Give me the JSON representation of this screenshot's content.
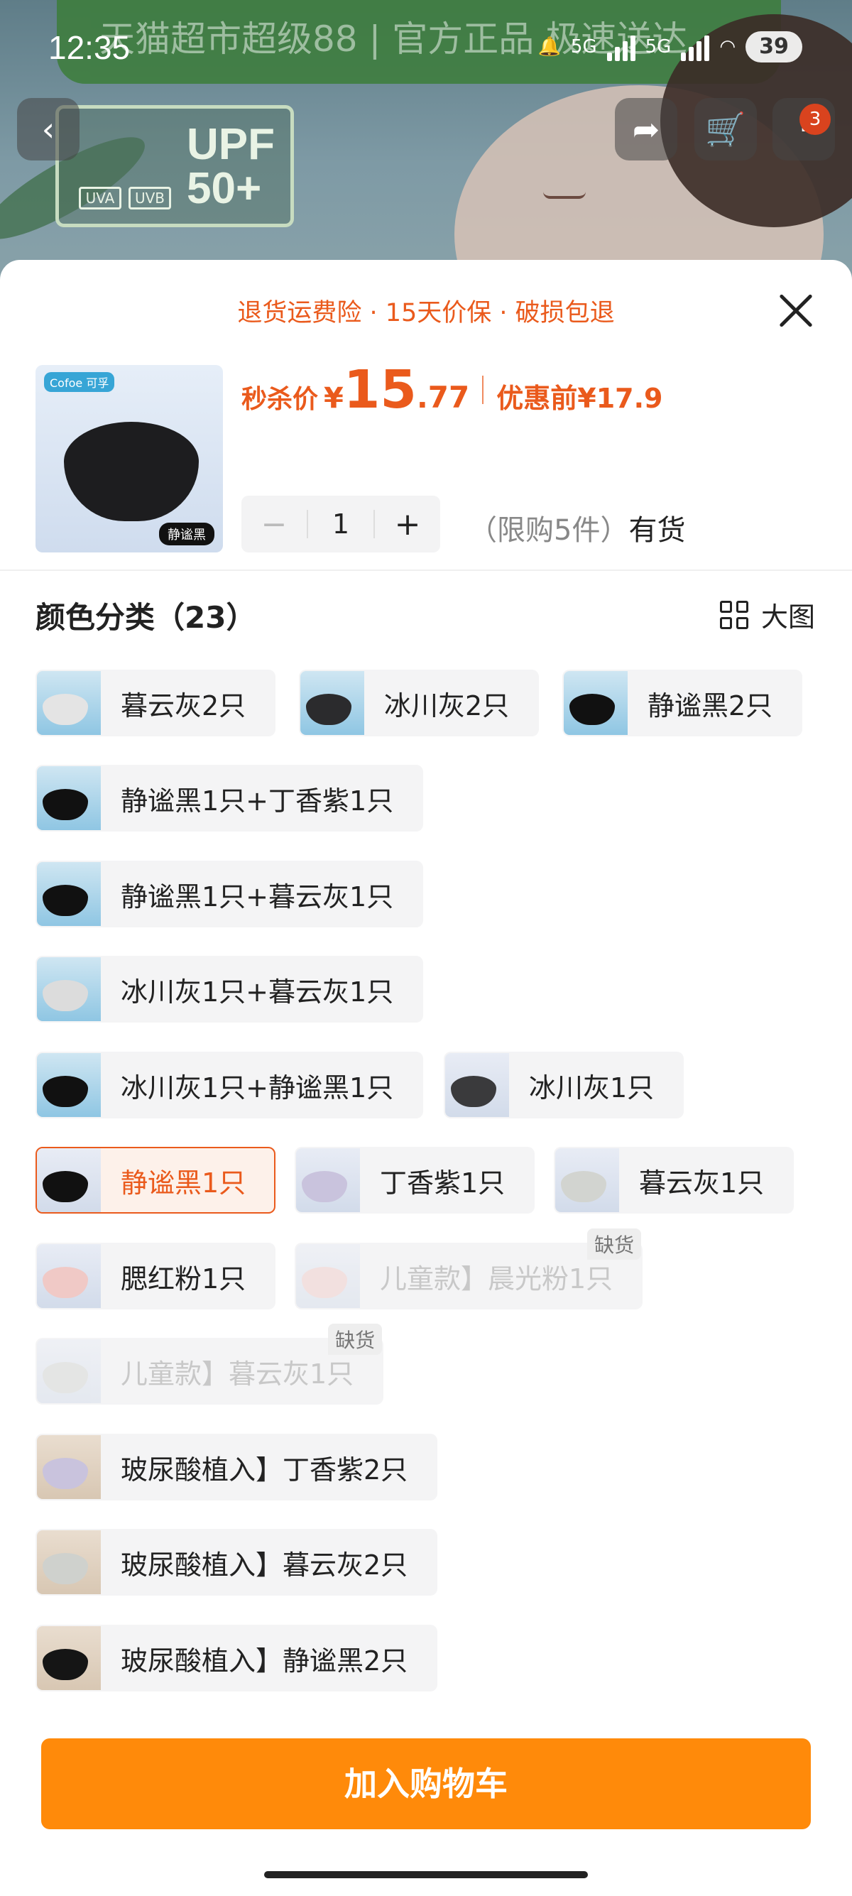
{
  "status_bar": {
    "time": "12:35",
    "network_1": "5G",
    "network_2": "5G",
    "battery": "39"
  },
  "background": {
    "banner_text": "天猫超市超级88 | 官方正品 极速送达",
    "upf_text": "UPF 50+",
    "uva": "UVA",
    "uvb": "UVB"
  },
  "nav": {
    "cart_badge": "3"
  },
  "sheet": {
    "promise": "退货运费险 · 15天价保 · 破损包退",
    "product": {
      "logo": "Cofoe 可孚",
      "tag": "静谧黑"
    },
    "price": {
      "label": "秒杀价",
      "currency": "¥",
      "integer": "15",
      "decimal": ".77",
      "original_label": "优惠前",
      "original": "¥17.9"
    },
    "quantity": {
      "minus": "−",
      "value": "1",
      "plus": "+"
    },
    "stock": {
      "limit": "（限购5件）",
      "status": "有货"
    },
    "category": {
      "title": "颜色分类（23）",
      "big_image": "大图"
    },
    "options": [
      {
        "label": "暮云灰2只"
      },
      {
        "label": "冰川灰2只"
      },
      {
        "label": "静谧黑2只"
      },
      {
        "label": "静谧黑1只+丁香紫1只"
      },
      {
        "label": "静谧黑1只+暮云灰1只"
      },
      {
        "label": "冰川灰1只+暮云灰1只"
      },
      {
        "label": "冰川灰1只+静谧黑1只"
      },
      {
        "label": "冰川灰1只"
      },
      {
        "label": "静谧黑1只",
        "selected": true
      },
      {
        "label": "丁香紫1只"
      },
      {
        "label": "暮云灰1只"
      },
      {
        "label": "腮红粉1只"
      },
      {
        "label": "儿童款】晨光粉1只",
        "out_of_stock": true
      },
      {
        "label": "儿童款】暮云灰1只",
        "out_of_stock": true
      },
      {
        "label": "玻尿酸植入】丁香紫2只"
      },
      {
        "label": "玻尿酸植入】暮云灰2只"
      },
      {
        "label": "玻尿酸植入】静谧黑2只"
      }
    ],
    "out_of_stock_label": "缺货",
    "add_to_cart": "加入购物车"
  },
  "colors": {
    "accent": "#ea5a1c",
    "button": "#ff8a0a",
    "chip_bg": "#f4f4f5"
  }
}
